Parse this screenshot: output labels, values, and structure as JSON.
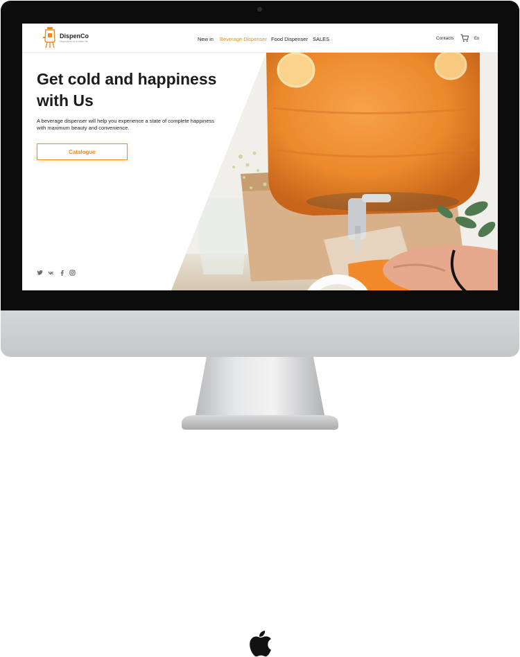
{
  "brand": {
    "name": "DispenCo",
    "tagline": "Dispensers for a better life"
  },
  "nav": {
    "items": [
      {
        "label": "New in",
        "active": false
      },
      {
        "label": "Beverage Dispenser",
        "active": true
      },
      {
        "label": "Food Dispenser",
        "active": false
      },
      {
        "label": "SALES",
        "active": false
      }
    ],
    "contacts": "Contacts",
    "language": "En"
  },
  "hero": {
    "title": "Get cold and happiness with Us",
    "subtitle": "A beverage dispenser will help you experience a state of complete happiness with maximum beauty and convenience.",
    "cta": "Catalogue"
  },
  "social": [
    "twitter-icon",
    "vk-icon",
    "facebook-icon",
    "instagram-icon"
  ],
  "colors": {
    "accent": "#f08a1e",
    "text": "#1b1b1b",
    "bezel": "#0c0c0c",
    "chin": "#cfd0d2"
  }
}
